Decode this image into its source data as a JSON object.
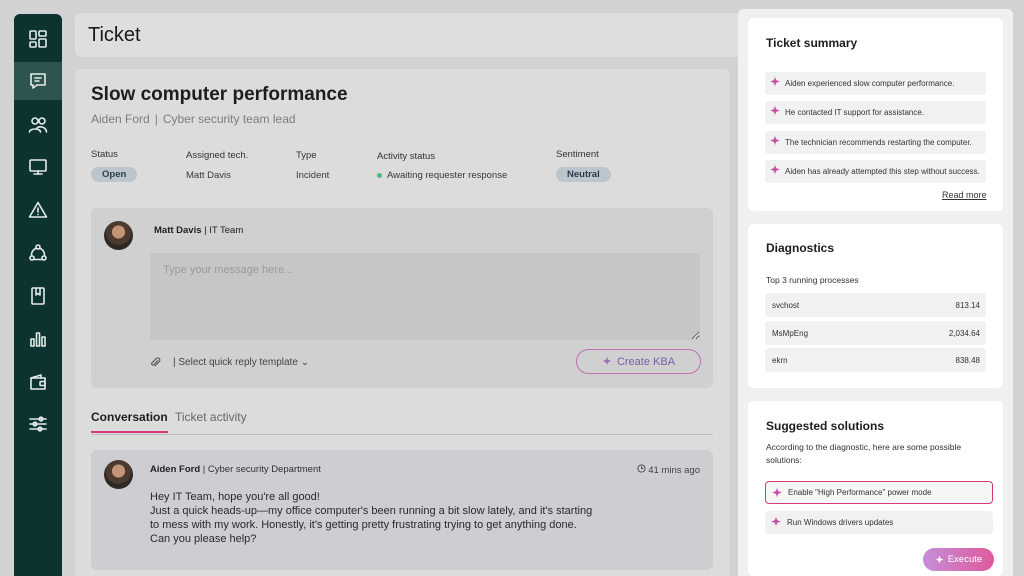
{
  "colors": {
    "sidebar_bg": "#0d3330",
    "accent": "#d63a7c",
    "sparkle": "#c84fa8",
    "status_dot": "#4bbf83"
  },
  "sidebar": {
    "items": [
      {
        "icon": "dashboard-icon"
      },
      {
        "icon": "chat-icon",
        "active": true
      },
      {
        "icon": "users-icon"
      },
      {
        "icon": "monitor-icon"
      },
      {
        "icon": "alert-triangle-icon"
      },
      {
        "icon": "network-icon"
      },
      {
        "icon": "book-icon"
      },
      {
        "icon": "bar-chart-icon"
      },
      {
        "icon": "wallet-icon"
      },
      {
        "icon": "sliders-icon"
      }
    ]
  },
  "header": {
    "title": "Ticket"
  },
  "ticket": {
    "title": "Slow computer performance",
    "requester_name": "Aiden Ford",
    "requester_role": "Cyber security team lead",
    "fields": {
      "status_label": "Status",
      "status_value": "Open",
      "tech_label": "Assigned tech.",
      "tech_value": "Matt Davis",
      "type_label": "Type",
      "type_value": "Incident",
      "activity_label": "Activity status",
      "activity_value": "Awaiting requester response",
      "sentiment_label": "Sentiment",
      "sentiment_value": "Neutral"
    }
  },
  "composer": {
    "author_name": "Matt Davis",
    "author_team": "| IT Team",
    "placeholder": "Type your message here...",
    "quick_reply": "|  Select quick reply template",
    "create_kba": "Create KBA"
  },
  "tabs": [
    {
      "label": "Conversation",
      "active": true
    },
    {
      "label": "Ticket activity"
    }
  ],
  "message": {
    "author_name": "Aiden Ford",
    "author_dept": "| Cyber security Department",
    "time": "41 mins ago",
    "lines": [
      "Hey IT Team, hope you're all good!",
      " Just a quick heads-up—my office computer's been running a bit slow lately, and it's starting",
      "to mess with my work. Honestly, it's getting pretty frustrating trying to get anything done.",
      "Can you please help?"
    ]
  },
  "summary": {
    "title": "Ticket summary",
    "items": [
      "Aiden experienced slow computer performance.",
      "He contacted IT support for assistance.",
      "The technician recommends restarting the computer.",
      "Aiden has already attempted this step without success."
    ],
    "read_more": "Read more"
  },
  "diagnostics": {
    "title": "Diagnostics",
    "subtitle": "Top 3 running processes",
    "processes": [
      {
        "name": "svchost",
        "value": "813.14"
      },
      {
        "name": "MsMpEng",
        "value": "2,034.64"
      },
      {
        "name": "ekrn",
        "value": "838.48"
      }
    ]
  },
  "solutions": {
    "title": "Suggested solutions",
    "subtitle": "According to the diagnostic, here are some possible solutions:",
    "items": [
      {
        "label": "Enable \"High Performance\" power mode",
        "selected": true
      },
      {
        "label": "Run Windows drivers updates",
        "selected": false
      }
    ],
    "execute": "Execute"
  }
}
